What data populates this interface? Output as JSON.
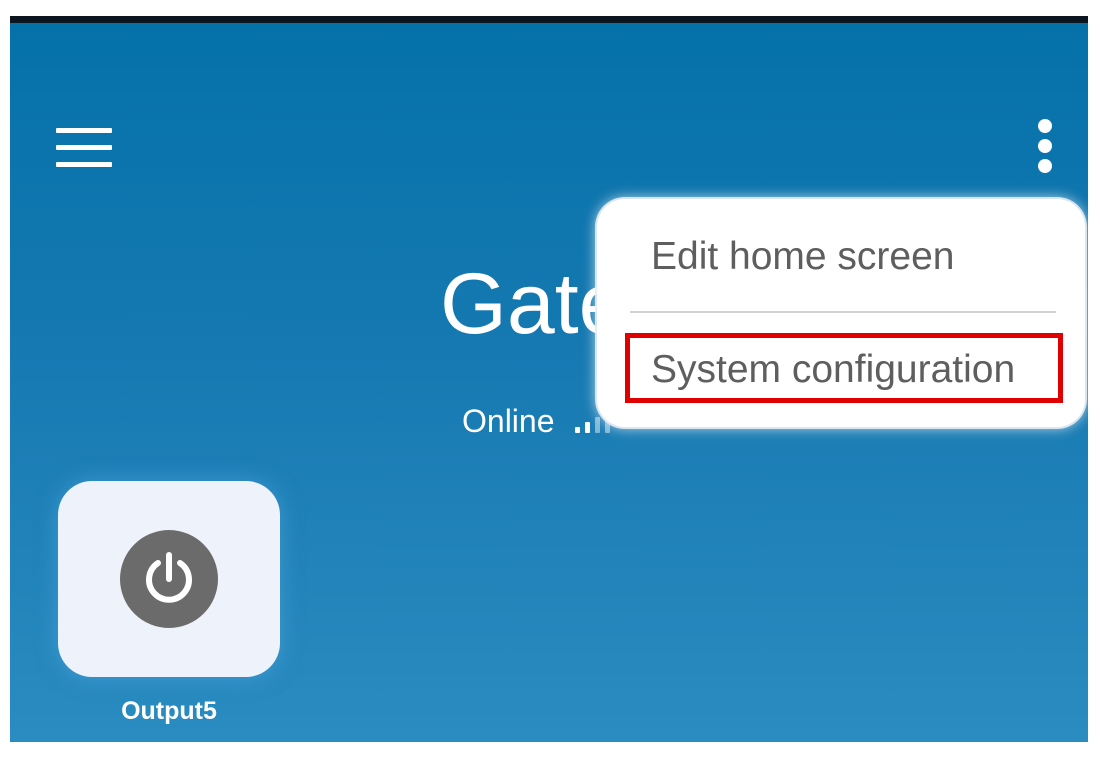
{
  "header": {
    "menu_icon": "hamburger-menu-icon",
    "overflow_icon": "more-vertical-icon"
  },
  "device": {
    "title": "Gateway",
    "status": "Online",
    "signal_icon": "signal-strength-icon",
    "signal_bars_active": 2,
    "signal_bars_total": 4
  },
  "tiles": [
    {
      "label": "Output5",
      "icon": "power-icon",
      "icon_bg": "#6b6b6b"
    }
  ],
  "overflow_menu": {
    "items": [
      {
        "label": "Edit home screen"
      },
      {
        "label": "System configuration",
        "highlighted": true
      }
    ],
    "highlight_color": "#e10000"
  },
  "colors": {
    "background_top": "#0571a9",
    "background_bottom": "#2a8cc0",
    "tile_bg": "#eef3fb",
    "menu_text": "#5e5e5e"
  }
}
